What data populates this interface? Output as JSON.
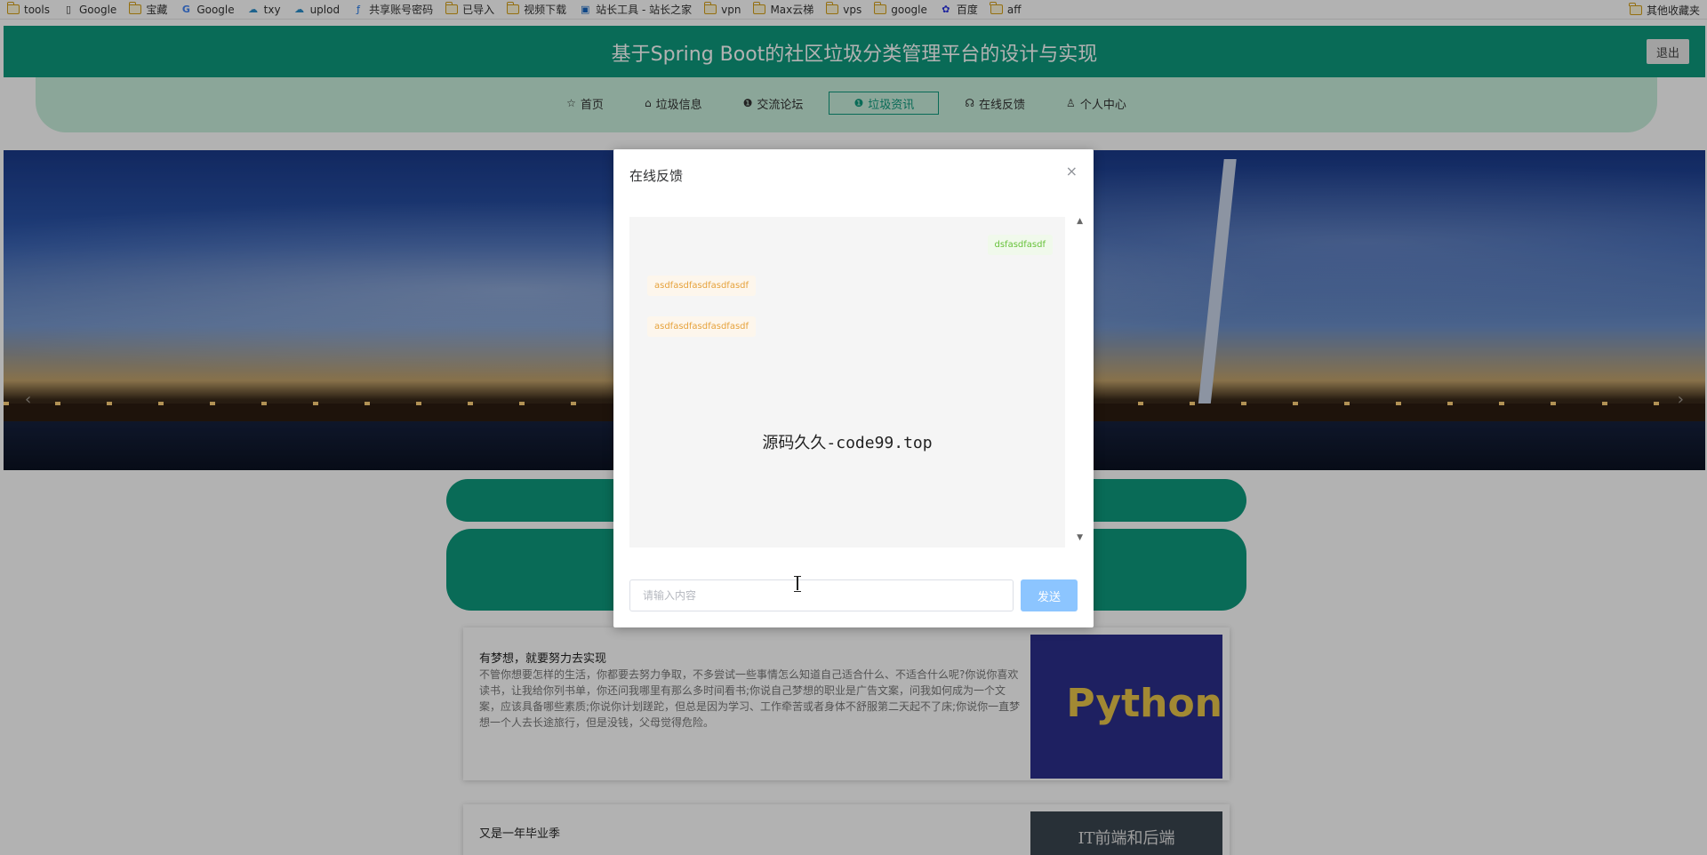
{
  "bookmarks": {
    "items": [
      {
        "label": "tools",
        "icon": "folder-icon"
      },
      {
        "label": "Google",
        "icon": "page-icon"
      },
      {
        "label": "宝藏",
        "icon": "folder-icon"
      },
      {
        "label": "Google",
        "icon": "google-icon"
      },
      {
        "label": "txy",
        "icon": "cloud-icon"
      },
      {
        "label": "uplod",
        "icon": "cloud-icon"
      },
      {
        "label": "共享账号密码",
        "icon": "app-icon"
      },
      {
        "label": "已导入",
        "icon": "folder-icon"
      },
      {
        "label": "视频下载",
        "icon": "folder-icon"
      },
      {
        "label": "站长工具 - 站长之家",
        "icon": "site-icon"
      },
      {
        "label": "vpn",
        "icon": "folder-icon"
      },
      {
        "label": "Max云梯",
        "icon": "folder-icon"
      },
      {
        "label": "vps",
        "icon": "folder-icon"
      },
      {
        "label": "google",
        "icon": "folder-icon"
      },
      {
        "label": "百度",
        "icon": "baidu-icon"
      },
      {
        "label": "aff",
        "icon": "folder-icon"
      }
    ],
    "other": "其他收藏夹"
  },
  "header": {
    "title": "基于Spring Boot的社区垃圾分类管理平台的设计与实现",
    "logout": "退出"
  },
  "nav": [
    {
      "label": "首页",
      "icon": "☆"
    },
    {
      "label": "垃圾信息",
      "icon": "⌂"
    },
    {
      "label": "交流论坛",
      "icon": "❶"
    },
    {
      "label": "垃圾资讯",
      "icon": "❶"
    },
    {
      "label": "在线反馈",
      "icon": "☊"
    },
    {
      "label": "个人中心",
      "icon": "♙"
    }
  ],
  "articles": [
    {
      "title": "有梦想，就要努力去实现",
      "body": "不管你想要怎样的生活，你都要去努力争取，不多尝试一些事情怎么知道自己适合什么、不适合什么呢?你说你喜欢读书，让我给你列书单，你还问我哪里有那么多时间看书;你说自己梦想的职业是广告文案，问我如何成为一个文案，应该具备哪些素质;你说你计划蹉跎，但总是因为学习、工作牵苦或者身体不舒服第二天起不了床;你说你一直梦想一个人去长途旅行，但是没钱，父母觉得危险。",
      "thumb_text": "Python"
    },
    {
      "title": "又是一年毕业季",
      "body": "",
      "thumb_text": "IT前端和后端"
    }
  ],
  "modal": {
    "title": "在线反馈",
    "close": "×",
    "messages": [
      {
        "side": "right",
        "text": "dsfasdfasdf"
      },
      {
        "side": "left",
        "text": "asdfasdfasdfasdfasdf"
      },
      {
        "side": "left",
        "text": "asdfasdfasdfasdfasdf"
      }
    ],
    "watermark": "源码久久-code99.top",
    "input_placeholder": "请输入内容",
    "send": "发送"
  },
  "colors": {
    "brand": "#0e9a7d",
    "nav_bg": "#c8eedb",
    "send_button": "#8cc5ff",
    "msg_right": "#67c23a",
    "msg_left": "#e6a23c"
  }
}
